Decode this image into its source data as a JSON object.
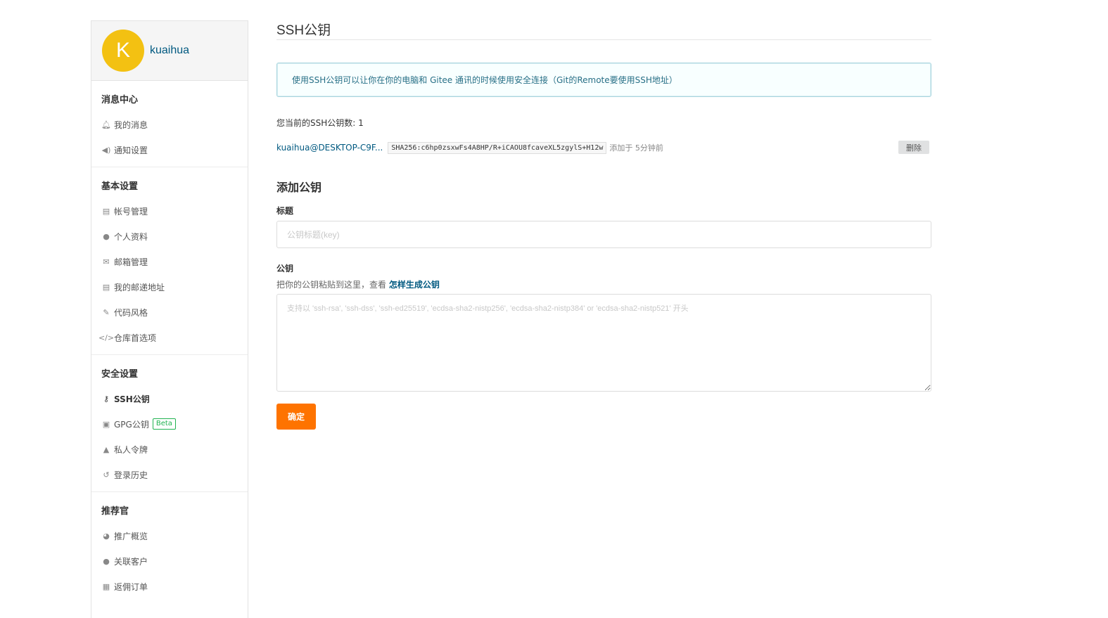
{
  "user": {
    "avatar_letter": "K",
    "username": "kuaihua"
  },
  "sidebar": {
    "sections": [
      {
        "title": "消息中心",
        "items": [
          {
            "label": "我的消息",
            "icon": "bell-icon"
          },
          {
            "label": "通知设置",
            "icon": "megaphone-icon"
          }
        ]
      },
      {
        "title": "基本设置",
        "items": [
          {
            "label": "帐号管理",
            "icon": "id-card-icon"
          },
          {
            "label": "个人资料",
            "icon": "user-icon"
          },
          {
            "label": "邮箱管理",
            "icon": "envelope-icon"
          },
          {
            "label": "我的邮递地址",
            "icon": "address-card-icon"
          },
          {
            "label": "代码风格",
            "icon": "paintbrush-icon"
          },
          {
            "label": "仓库首选项",
            "icon": "code-icon"
          }
        ]
      },
      {
        "title": "安全设置",
        "items": [
          {
            "label": "SSH公钥",
            "icon": "key-icon",
            "active": true
          },
          {
            "label": "GPG公钥",
            "icon": "lock-icon",
            "badge": "Beta"
          },
          {
            "label": "私人令牌",
            "icon": "token-icon"
          },
          {
            "label": "登录历史",
            "icon": "history-icon"
          }
        ]
      },
      {
        "title": "推荐官",
        "items": [
          {
            "label": "推广概览",
            "icon": "pie-chart-icon"
          },
          {
            "label": "关联客户",
            "icon": "user-link-icon"
          },
          {
            "label": "返佣订单",
            "icon": "order-icon"
          }
        ]
      }
    ]
  },
  "main": {
    "title": "SSH公钥",
    "info": "使用SSH公钥可以让你在你的电脑和 Gitee 通讯的时候使用安全连接（Git的Remote要使用SSH地址）",
    "count_text": "您当前的SSH公钥数: 1",
    "keys": [
      {
        "name": "kuaihua@DESKTOP-C9F...",
        "fingerprint": "SHA256:c6hp0zsxwFs4A8HP/R+iCAOU8fcaveXL5zgylS+H12w",
        "time": "添加于 5分钟前",
        "delete_label": "删除"
      }
    ],
    "add_title": "添加公钥",
    "title_label": "标题",
    "title_placeholder": "公钥标题(key)",
    "key_label": "公钥",
    "key_hint": "把你的公钥粘贴到这里，查看",
    "key_hint_link": "怎样生成公钥",
    "key_placeholder": "支持以 'ssh-rsa', 'ssh-dss', 'ssh-ed25519', 'ecdsa-sha2-nistp256', 'ecdsa-sha2-nistp384' or 'ecdsa-sha2-nistp521' 开头",
    "submit_label": "确定"
  },
  "colors": {
    "accent": "#fe7300",
    "link": "#005980",
    "avatar": "#f3c112",
    "beta": "#21b351"
  }
}
